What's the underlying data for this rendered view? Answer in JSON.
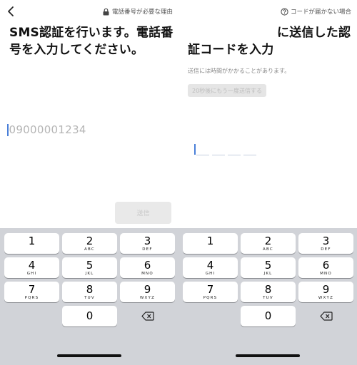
{
  "left_screen": {
    "help_link": "電話番号が必要な理由",
    "title_lines": [
      "SMS認証を行います。電話番",
      "号を入力してください。"
    ],
    "phone_placeholder": "09000001234",
    "send_button": "送信"
  },
  "right_screen": {
    "help_link": "コードが届かない場合",
    "title_lines": [
      "に送信した認",
      "証コードを入力"
    ],
    "subtext": "送信には時間がかかることがあります。",
    "resend_button": "20秒後にもう一度送信する"
  },
  "keypad": {
    "keys": [
      {
        "digit": "1",
        "letters": ""
      },
      {
        "digit": "2",
        "letters": "ABC"
      },
      {
        "digit": "3",
        "letters": "DEF"
      },
      {
        "digit": "4",
        "letters": "GHI"
      },
      {
        "digit": "5",
        "letters": "JKL"
      },
      {
        "digit": "6",
        "letters": "MNO"
      },
      {
        "digit": "7",
        "letters": "PQRS"
      },
      {
        "digit": "8",
        "letters": "TUV"
      },
      {
        "digit": "9",
        "letters": "WXYZ"
      },
      {
        "digit": "0",
        "letters": ""
      }
    ],
    "delete_icon": "backspace-icon"
  },
  "colors": {
    "caret": "#4a7fd8",
    "keyboard_bg": "#d1d3d8",
    "key_bg": "#ffffff",
    "disabled_button_bg": "#e9e9e9"
  }
}
